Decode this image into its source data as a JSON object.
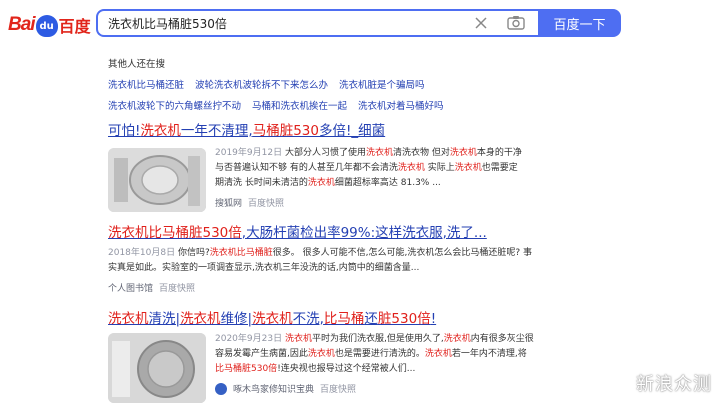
{
  "header": {
    "logo_text_left": "Bai",
    "logo_paw_text": "du",
    "logo_text_right": "百度",
    "search_value": "洗衣机比马桶脏530倍",
    "search_button": "百度一下"
  },
  "related": {
    "title": "其他人还在搜",
    "row1": [
      "洗衣机比马桶还脏",
      "波轮洗衣机波轮拆不下来怎么办",
      "洗衣机脏是个骗局吗"
    ],
    "row2": [
      "洗衣机波轮下的六角螺丝拧不动",
      "马桶和洗衣机挨在一起",
      "洗衣机对着马桶好吗"
    ]
  },
  "results": [
    {
      "title_parts": [
        "可怕!",
        "洗衣机",
        "一年不清理,",
        "马桶脏530",
        "多倍!_细菌"
      ],
      "date": "2019年9月12日",
      "abstract_parts": [
        " 大部分人习惯了使用",
        "洗衣机",
        "清洗衣物 但对",
        "洗衣机",
        "本身的干净与否普遍认知不够 有的人甚至几年都不会清洗",
        "洗衣机",
        " 实际上",
        "洗衣机",
        "也需要定期清洗 长时间未清洁的",
        "洗衣机",
        "细菌超标率高达 81.3% ..."
      ],
      "source": "搜狐网",
      "snapshot": "百度快照"
    },
    {
      "title_parts": [
        "洗衣机比马桶脏530倍",
        ",大肠杆菌检出率99%:这样洗衣服,洗了..."
      ],
      "date": "2018年10月8日",
      "abstract_parts": [
        " 你信吗?",
        "洗衣机比马桶脏",
        "很多。 很多人可能不信,怎么可能,洗衣机怎么会比马桶还脏呢? 事实真是如此。实验室的一项调查显示,洗衣机三年没洗的话,内筒中的细菌含量..."
      ],
      "source": "个人图书馆",
      "snapshot": "百度快照"
    },
    {
      "title_parts": [
        "洗衣机",
        "清洗|",
        "洗衣机",
        "维修|",
        "洗衣机",
        "不洗,",
        "比马桶",
        "还",
        "脏530倍",
        "!"
      ],
      "date": "2020年9月23日",
      "abstract_parts": [
        " ",
        "洗衣机",
        "平时为我们洗衣服,但是使用久了,",
        "洗衣机",
        "内有很多灰尘很容易发霉产生病菌,因此",
        "洗衣机",
        "也是需要进行清洗的。",
        "洗衣机",
        "若一年内不清理,将",
        "比马桶脏530倍",
        "!连央视也报导过这个经常被人们..."
      ],
      "source": "啄木鸟家修知识宝典",
      "snapshot": "百度快照"
    }
  ],
  "watermark": "新浪众测"
}
